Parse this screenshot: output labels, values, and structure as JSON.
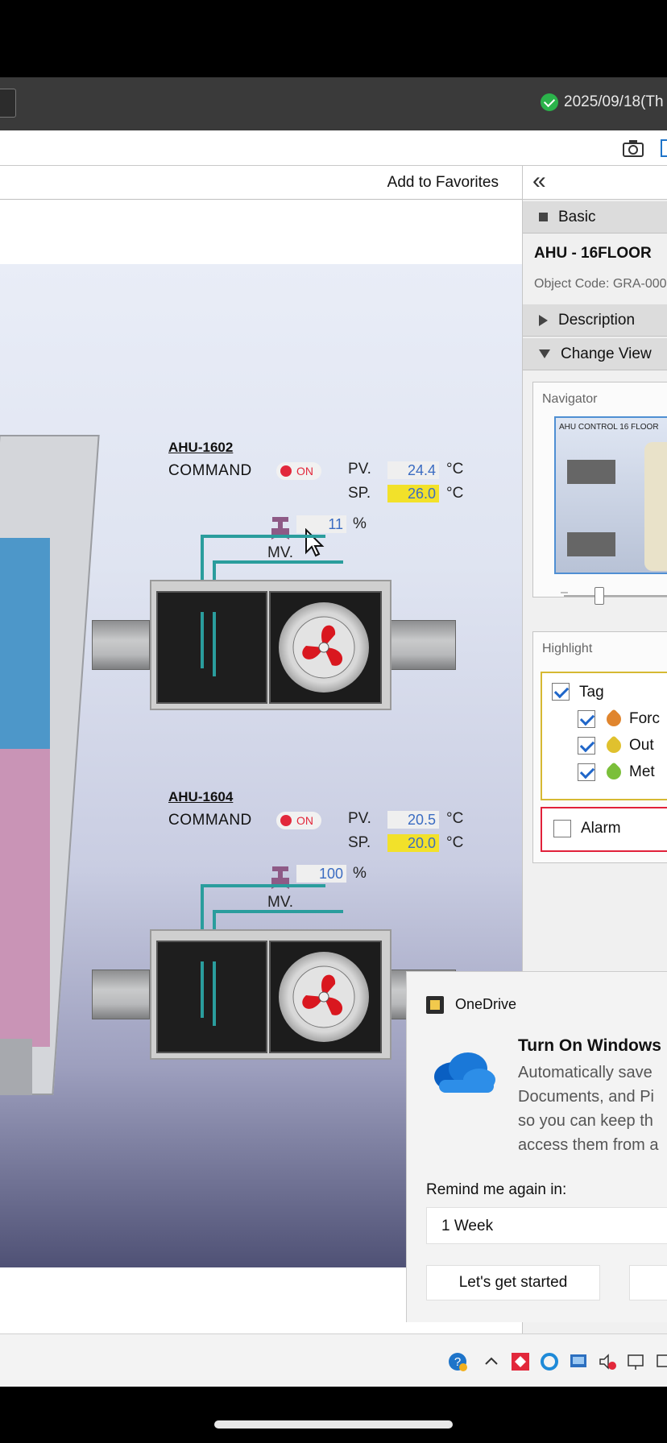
{
  "statusbar": {
    "datetime": "2025/09/18(Th"
  },
  "main": {
    "favorites": "Add to Favorites"
  },
  "ahus": [
    {
      "name": "AHU-1602",
      "command_label": "COMMAND",
      "status": "ON",
      "pv_label": "PV.",
      "pv": "24.4",
      "sp_label": "SP.",
      "sp": "26.0",
      "unit": "°C",
      "mv_label": "MV.",
      "mv": "11",
      "mv_unit": "%"
    },
    {
      "name": "AHU-1604",
      "command_label": "COMMAND",
      "status": "ON",
      "pv_label": "PV.",
      "pv": "20.5",
      "sp_label": "SP.",
      "sp": "20.0",
      "unit": "°C",
      "mv_label": "MV.",
      "mv": "100",
      "mv_unit": "%"
    }
  ],
  "panel": {
    "collapse_icon": "«",
    "basic": "Basic",
    "object_name": "AHU - 16FLOOR",
    "object_code": "Object Code: GRA-000",
    "description": "Description",
    "change_view": "Change View",
    "navigator": "Navigator",
    "navigator_thumb_title": "AHU CONTROL 16 FLOOR",
    "highlight": "Highlight",
    "tag": "Tag",
    "tags": [
      {
        "label": "Forc",
        "color": "#e0852e",
        "checked": true
      },
      {
        "label": "Out",
        "color": "#e0c12e",
        "checked": true
      },
      {
        "label": "Met",
        "color": "#7bbf3a",
        "checked": true
      }
    ],
    "alarm": "Alarm"
  },
  "toast": {
    "app_name": "OneDrive",
    "title": "Turn On Windows",
    "lines": [
      "Automatically save",
      "Documents, and Pi",
      "so you can keep th",
      "access them from a"
    ],
    "remind_label": "Remind me again in:",
    "remind_value": "1 Week",
    "primary_button": "Let's get started"
  },
  "colors": {
    "accent": "#1e74c9",
    "status_on": "#e2283b",
    "setpoint_bg": "#f2e12a",
    "pipe": "#2a9d9d"
  }
}
